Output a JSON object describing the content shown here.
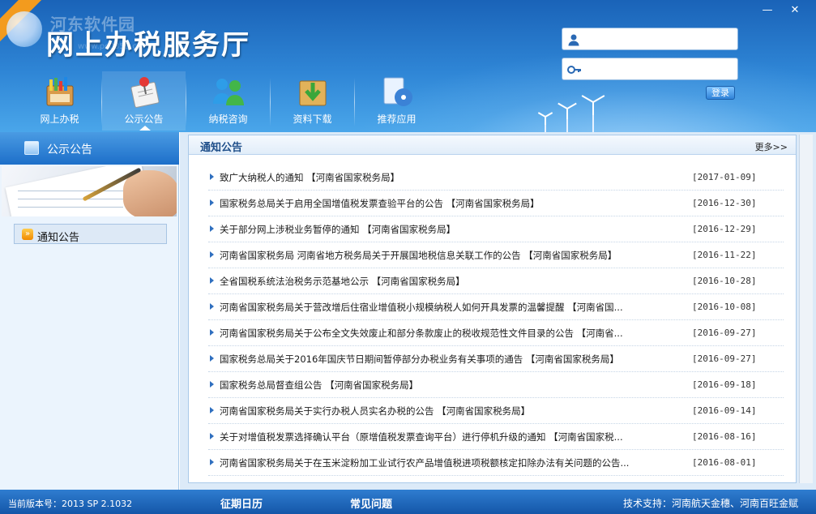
{
  "header": {
    "title": "网上办税服务厅",
    "watermark": "河东软件园",
    "watermark_url": "www.pc0359.cn",
    "minimize_label": "—",
    "close_label": "✕"
  },
  "login": {
    "username_value": "",
    "password_value": "",
    "login_label": "登录"
  },
  "nav": {
    "items": [
      {
        "label": "网上办税",
        "icon": "online-tax-icon"
      },
      {
        "label": "公示公告",
        "icon": "notice-pin-icon",
        "active": true
      },
      {
        "label": "纳税咨询",
        "icon": "consult-people-icon"
      },
      {
        "label": "资料下载",
        "icon": "download-box-icon"
      },
      {
        "label": "推荐应用",
        "icon": "app-disc-icon"
      }
    ]
  },
  "sidebar": {
    "header_label": "公示公告",
    "items": [
      {
        "label": "通知公告"
      }
    ]
  },
  "panel": {
    "title": "通知公告",
    "more_label": "更多>>",
    "notices": [
      {
        "title": "致广大纳税人的通知 【河南省国家税务局】",
        "date": "[2017-01-09]"
      },
      {
        "title": "国家税务总局关于启用全国增值税发票查验平台的公告 【河南省国家税务局】",
        "date": "[2016-12-30]"
      },
      {
        "title": "关于部分网上涉税业务暂停的通知 【河南省国家税务局】",
        "date": "[2016-12-29]"
      },
      {
        "title": "河南省国家税务局 河南省地方税务局关于开展国地税信息关联工作的公告 【河南省国家税务局】",
        "date": "[2016-11-22]"
      },
      {
        "title": "全省国税系统法治税务示范基地公示 【河南省国家税务局】",
        "date": "[2016-10-28]"
      },
      {
        "title": "河南省国家税务局关于营改增后住宿业增值税小规模纳税人如何开具发票的温馨提醒 【河南省国...",
        "date": "[2016-10-08]"
      },
      {
        "title": "河南省国家税务局关于公布全文失效废止和部分条款废止的税收规范性文件目录的公告 【河南省...",
        "date": "[2016-09-27]"
      },
      {
        "title": "国家税务总局关于2016年国庆节日期间暂停部分办税业务有关事项的通告 【河南省国家税务局】",
        "date": "[2016-09-27]"
      },
      {
        "title": "国家税务总局督查组公告 【河南省国家税务局】",
        "date": "[2016-09-18]"
      },
      {
        "title": "河南省国家税务局关于实行办税人员实名办税的公告 【河南省国家税务局】",
        "date": "[2016-09-14]"
      },
      {
        "title": "关于对增值税发票选择确认平台（原增值税发票查询平台）进行停机升级的通知 【河南省国家税...",
        "date": "[2016-08-16]"
      },
      {
        "title": "河南省国家税务局关于在玉米淀粉加工业试行农产品增值税进项税额核定扣除办法有关问题的公告...",
        "date": "[2016-08-01]"
      }
    ]
  },
  "footer": {
    "version": "当前版本号：2013 SP 2.1032",
    "calendar_label": "征期日历",
    "faq_label": "常见问题",
    "support": "技术支持：河南航天金穗、河南百旺金赋"
  },
  "colors": {
    "header_top": "#1a63b8",
    "header_bottom": "#4aa6ea",
    "footer": "#1456a8",
    "link_bullet": "#2f6fbf"
  }
}
